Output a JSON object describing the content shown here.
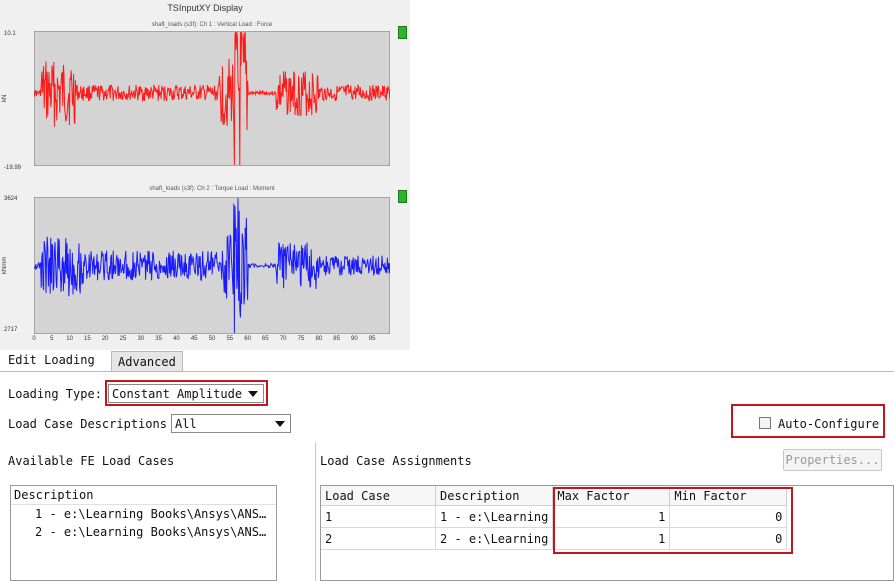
{
  "plot": {
    "window_title": "TSInputXY Display",
    "top_panel": {
      "title": "shaft_loads (s3f): Ch 1 : Vertical Load : Force",
      "y_max": "10.1",
      "y_min": "-19.99",
      "y_unit": "kN",
      "color": "#ff1a1a"
    },
    "bottom_panel": {
      "title": "shaft_loads (s3f): Ch 2 : Torque Load : Moment",
      "y_max": "3624",
      "y_min": "2717",
      "y_unit": "kNmm",
      "color": "#1a1aff"
    },
    "x_ticks": [
      "0",
      "5",
      "10",
      "15",
      "20",
      "25",
      "30",
      "35",
      "40",
      "45",
      "50",
      "55",
      "60",
      "65",
      "70",
      "75",
      "80",
      "85",
      "90",
      "95"
    ]
  },
  "tabs": {
    "edit_loading": "Edit Loading",
    "advanced": "Advanced"
  },
  "loading_type": {
    "label": "Loading Type:",
    "value": "Constant Amplitude"
  },
  "load_case_descriptions": {
    "label": "Load Case Descriptions",
    "value": "All"
  },
  "auto_configure": {
    "label": "Auto-Configure",
    "checked": false
  },
  "available": {
    "title": "Available FE Load Cases",
    "header": "Description",
    "items": [
      "1 - e:\\Learning Books\\Ansys\\ANS…",
      "2 - e:\\Learning Books\\Ansys\\ANS…"
    ]
  },
  "assignments": {
    "title": "Load Case Assignments",
    "properties_label": "Properties...",
    "columns": [
      "Load Case",
      "Description",
      "Max Factor",
      "Min Factor"
    ],
    "rows": [
      {
        "load_case": "1",
        "description": "1 - e:\\Learning",
        "max_factor": "1",
        "min_factor": "0"
      },
      {
        "load_case": "2",
        "description": "2 - e:\\Learning",
        "max_factor": "1",
        "min_factor": "0"
      }
    ]
  },
  "highlight_color": "#c0161d"
}
